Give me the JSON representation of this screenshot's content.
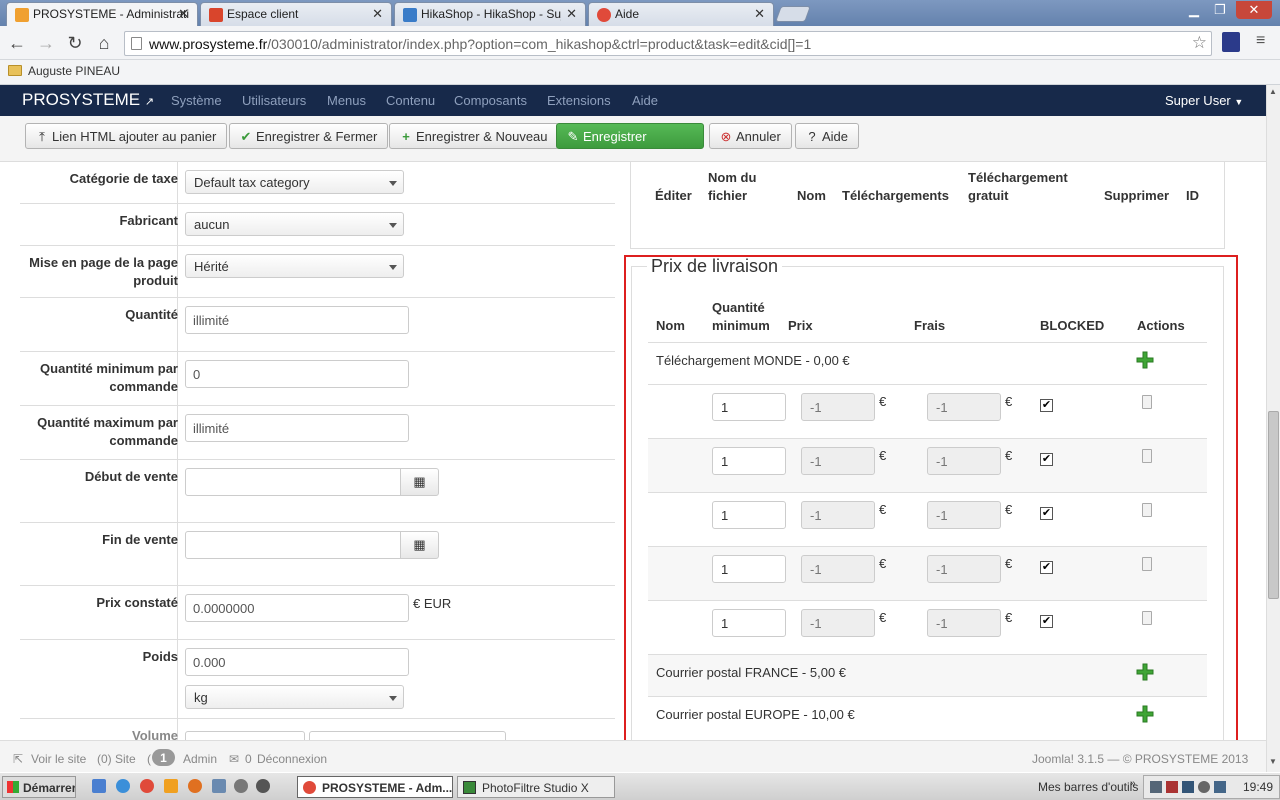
{
  "browser": {
    "tabs": [
      {
        "title": "PROSYSTEME - Administrati",
        "favicon_color": "#f0a030"
      },
      {
        "title": "Espace client",
        "favicon_color": "#d9452c"
      },
      {
        "title": "HikaShop - HikaShop - Sujet",
        "favicon_color": "#3a7cc8"
      },
      {
        "title": "Aide",
        "favicon_color": "#e04a3a"
      }
    ],
    "tab_close": "✕",
    "window_controls": {
      "minimize": "▁",
      "maximize": "❐",
      "close": "✕"
    },
    "url_host": "www.prosysteme.fr",
    "url_path": "/030010/administrator/index.php?option=com_hikashop&ctrl=product&task=edit&cid[]=1",
    "bookmark": "Auguste PINEAU"
  },
  "joomla": {
    "brand": "PROSYSTEME",
    "menu": [
      "Système",
      "Utilisateurs",
      "Menus",
      "Contenu",
      "Composants",
      "Extensions",
      "Aide"
    ],
    "user_menu": "Super User",
    "toolbar": {
      "html_link": "Lien HTML ajouter au panier",
      "save_close": "Enregistrer & Fermer",
      "save_new": "Enregistrer & Nouveau",
      "save": "Enregistrer",
      "cancel": "Annuler",
      "help": "Aide"
    }
  },
  "form": {
    "tax_category": {
      "label": "Catégorie de taxe",
      "value": "Default tax category"
    },
    "manufacturer": {
      "label": "Fabricant",
      "value": "aucun"
    },
    "layout": {
      "label": "Mise en page de la page produit",
      "value": "Hérité"
    },
    "quantity": {
      "label": "Quantité",
      "value": "illimité"
    },
    "min_qty": {
      "label": "Quantité minimum par commande",
      "value": "0"
    },
    "max_qty": {
      "label": "Quantité maximum par commande",
      "value": "illimité"
    },
    "sale_start": {
      "label": "Début de vente",
      "value": ""
    },
    "sale_end": {
      "label": "Fin de vente",
      "value": ""
    },
    "msrp": {
      "label": "Prix constaté",
      "value": "0.0000000",
      "currency": "€ EUR"
    },
    "weight": {
      "label": "Poids",
      "value": "0.000",
      "unit": "kg"
    },
    "volume": {
      "label": "Volume"
    }
  },
  "files_table": {
    "headers": [
      "Éditer",
      "Nom du fichier",
      "Nom",
      "Téléchargements",
      "Téléchargement gratuit",
      "Supprimer",
      "ID"
    ]
  },
  "shipping": {
    "legend": "Prix de livraison",
    "headers": {
      "name": "Nom",
      "min_qty": "Quantité minimum",
      "price": "Prix",
      "fee": "Frais",
      "blocked": "BLOCKED",
      "actions": "Actions"
    },
    "currency_symbol": "€",
    "zones": [
      {
        "label": "Téléchargement MONDE - 0,00 €"
      },
      {
        "label": "Courrier postal FRANCE - 5,00 €"
      },
      {
        "label": "Courrier postal EUROPE - 10,00 €"
      }
    ],
    "rows": [
      {
        "min_qty": "1",
        "price": "-1",
        "fee": "-1",
        "blocked": true
      },
      {
        "min_qty": "1",
        "price": "-1",
        "fee": "-1",
        "blocked": true
      },
      {
        "min_qty": "1",
        "price": "-1",
        "fee": "-1",
        "blocked": true
      },
      {
        "min_qty": "1",
        "price": "-1",
        "fee": "-1",
        "blocked": true
      },
      {
        "min_qty": "1",
        "price": "-1",
        "fee": "-1",
        "blocked": true
      }
    ]
  },
  "status_bar": {
    "view_site": "Voir le site",
    "site_count": "(0) Site",
    "admin_count": "1",
    "admin_label": "Admin",
    "logout_count": "0",
    "logout_label": "Déconnexion",
    "footer": "Joomla! 3.1.5 — © PROSYSTEME 2013"
  },
  "taskbar": {
    "start": "Démarrer",
    "windows": [
      "PROSYSTEME - Adm...",
      "PhotoFiltre Studio X"
    ],
    "toolbars_label": "Mes barres d'outils",
    "clock": "19:49"
  }
}
